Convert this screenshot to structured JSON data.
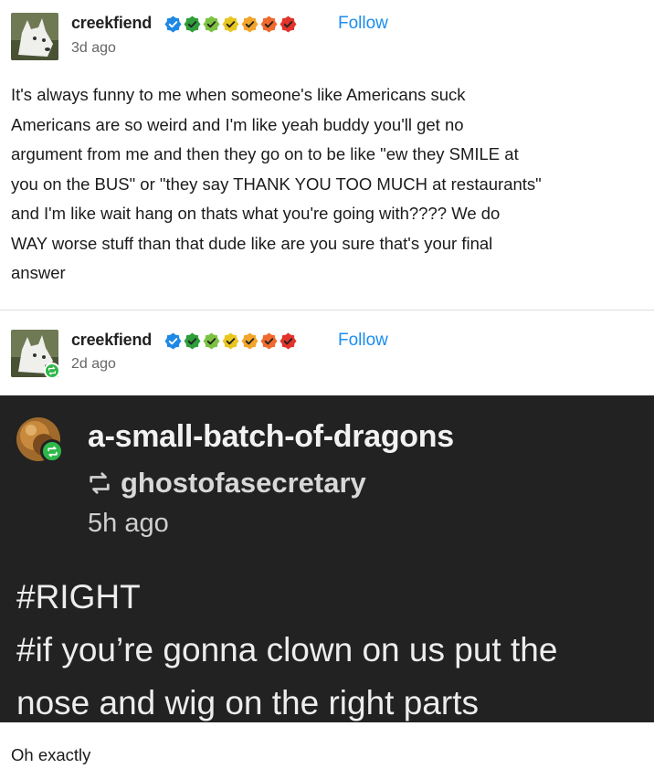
{
  "posts": [
    {
      "username": "creekfiend",
      "time": "3d ago",
      "follow_label": "Follow",
      "body": [
        "It's always funny to me when someone's like Americans suck",
        "Americans are so weird and I'm like yeah buddy you'll get no",
        "argument from me and then they go on to be like \"ew they SMILE at",
        "you on the BUS\" or \"they say THANK YOU TOO MUCH at restaurants\"",
        "and I'm like wait hang on thats what you're going with???? We do",
        "WAY worse stuff than that dude like are you sure that's your final",
        "answer"
      ]
    },
    {
      "username": "creekfiend",
      "time": "2d ago",
      "follow_label": "Follow"
    }
  ],
  "badges": {
    "icons": [
      "blue-check-badge-icon",
      "green-check-badge-icon",
      "lime-check-badge-icon",
      "yellow-check-badge-icon",
      "orange-check-badge-icon",
      "orange-red-check-badge-icon",
      "red-check-badge-icon"
    ],
    "colors": [
      "#1e88e5",
      "#2e9d3a",
      "#7cc242",
      "#e8c622",
      "#f2a52a",
      "#ef6a2c",
      "#e2342b"
    ]
  },
  "screenshot": {
    "username": "a-small-batch-of-dragons",
    "reblogged_from": "ghostofasecretary",
    "time": "5h ago",
    "tags": [
      "#RIGHT",
      "#if you’re gonna clown on us put the",
      "nose and wig on the right parts"
    ]
  },
  "reply": "Oh exactly",
  "colors": {
    "follow": "#1a8ef0",
    "reblog_badge": "#2fb84a",
    "dark_panel": "#222222"
  }
}
